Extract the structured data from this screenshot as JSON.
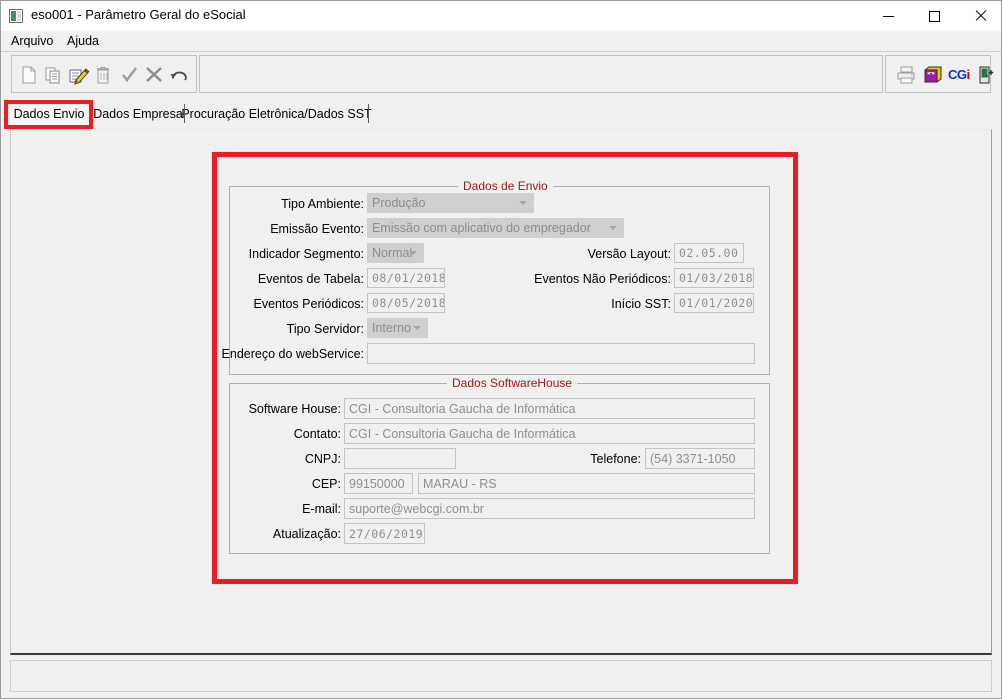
{
  "window": {
    "title": "eso001 - Parâmetro Geral do eSocial",
    "icon": "app-icon",
    "controls": {
      "minimize": "–",
      "maximize": "□",
      "close": "✕"
    }
  },
  "menu": {
    "items": [
      {
        "label": "Arquivo"
      },
      {
        "label": "Ajuda"
      }
    ]
  },
  "toolbar": {
    "left_icons": [
      {
        "name": "new-record-icon",
        "title": "Novo"
      },
      {
        "name": "copy-record-icon",
        "title": "Copiar"
      },
      {
        "name": "edit-record-icon",
        "title": "Editar"
      },
      {
        "name": "delete-record-icon",
        "title": "Excluir"
      },
      {
        "name": "confirm-check-icon",
        "title": "Confirmar"
      },
      {
        "name": "cancel-x-icon",
        "title": "Cancelar"
      },
      {
        "name": "undo-icon",
        "title": "Desfazer"
      }
    ],
    "right_icons": [
      {
        "name": "print-icon",
        "title": "Imprimir"
      },
      {
        "name": "notebook-icon",
        "title": "Anotações"
      },
      {
        "name": "cgi-logo-icon",
        "title": "CGi"
      },
      {
        "name": "exit-door-icon",
        "title": "Sair"
      }
    ],
    "cgi_logo": {
      "part1": "CG",
      "part2": "i"
    }
  },
  "tabs": {
    "active_index": 0,
    "items": [
      {
        "label": "Dados Envio"
      },
      {
        "label": "Dados Empresa"
      },
      {
        "label": "Procuração Eletrônica/Dados SST"
      }
    ]
  },
  "colors": {
    "highlight": "#ec1c24",
    "group_title": "#a01818",
    "disabled_text": "#8f8f8f",
    "combo_bg": "#cfcfcf",
    "window_bg": "#f0f0f0"
  },
  "groups": {
    "envio": {
      "title": "Dados de Envio",
      "fields": {
        "tipo_ambiente": {
          "label": "Tipo Ambiente:",
          "value": "Produção",
          "type": "combobox"
        },
        "emissao_evento": {
          "label": "Emissão Evento:",
          "value": "Emissão com aplicativo do empregador",
          "type": "combobox"
        },
        "indicador_seg": {
          "label": "Indicador Segmento:",
          "value": "Normal",
          "type": "combobox"
        },
        "versao_layout": {
          "label": "Versão Layout:",
          "value": "02.05.00",
          "type": "text"
        },
        "eventos_tabela": {
          "label": "Eventos de Tabela:",
          "value": "08/01/2018",
          "type": "text"
        },
        "eventos_nao_per": {
          "label": "Eventos Não Periódicos:",
          "value": "01/03/2018",
          "type": "text"
        },
        "eventos_per": {
          "label": "Eventos Periódicos:",
          "value": "08/05/2018",
          "type": "text"
        },
        "inicio_sst": {
          "label": "Início SST:",
          "value": "01/01/2020",
          "type": "text"
        },
        "tipo_servidor": {
          "label": "Tipo Servidor:",
          "value": "Interno",
          "type": "combobox"
        },
        "endereco_ws": {
          "label": "Endereço do webService:",
          "value": "",
          "type": "text"
        }
      }
    },
    "softwarehouse": {
      "title": "Dados SoftwareHouse",
      "fields": {
        "software_house": {
          "label": "Software House:",
          "value": "CGI - Consultoria Gaucha de Informática",
          "type": "text"
        },
        "contato": {
          "label": "Contato:",
          "value": "CGI - Consultoria Gaucha de Informática",
          "type": "text"
        },
        "cnpj": {
          "label": "CNPJ:",
          "value": "",
          "type": "text"
        },
        "telefone": {
          "label": "Telefone:",
          "value": "(54) 3371-1050",
          "type": "text"
        },
        "cep": {
          "label": "CEP:",
          "value": "99150000",
          "type": "text"
        },
        "cidade_uf": {
          "label": "",
          "value": "MARAU - RS",
          "type": "text"
        },
        "email": {
          "label": "E-mail:",
          "value": "suporte@webcgi.com.br",
          "type": "text"
        },
        "atualizacao": {
          "label": "Atualização:",
          "value": "27/06/2019",
          "type": "text"
        }
      }
    }
  },
  "statusbar": {
    "text": ""
  }
}
